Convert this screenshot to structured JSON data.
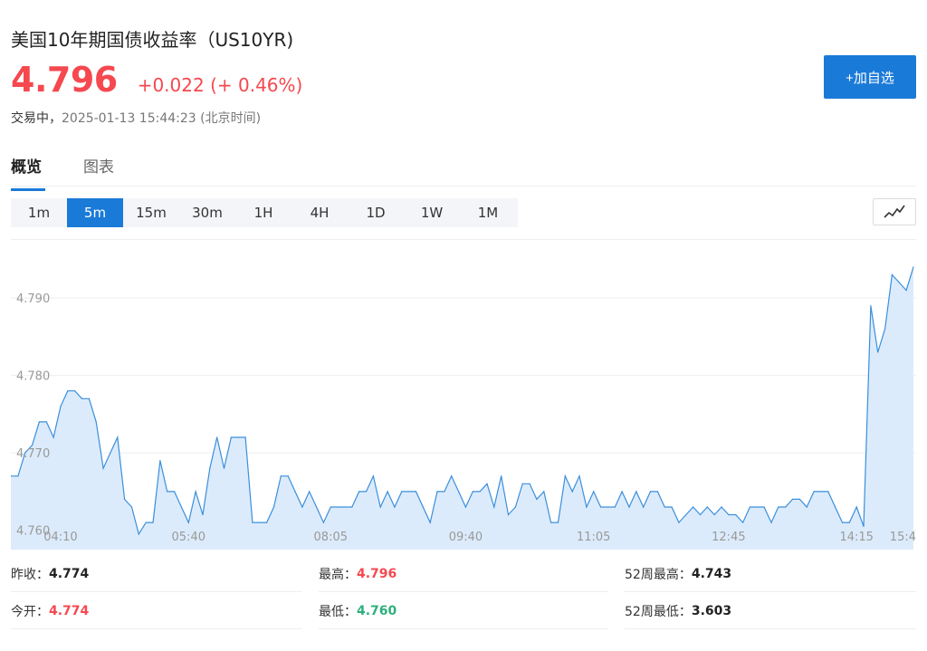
{
  "header": {
    "title": "美国10年期国债收益率（US10YR)",
    "price": "4.796",
    "change": "+0.022 (+ 0.46%)",
    "status_label": "交易中，",
    "timestamp": "2025-01-13 15:44:23 (北京时间)",
    "watch_button": "+加自选"
  },
  "tabs": [
    {
      "label": "概览",
      "active": true
    },
    {
      "label": "图表",
      "active": false
    }
  ],
  "intervals": [
    {
      "label": "1m",
      "active": false
    },
    {
      "label": "5m",
      "active": true
    },
    {
      "label": "15m",
      "active": false
    },
    {
      "label": "30m",
      "active": false
    },
    {
      "label": "1H",
      "active": false
    },
    {
      "label": "4H",
      "active": false
    },
    {
      "label": "1D",
      "active": false
    },
    {
      "label": "1W",
      "active": false
    },
    {
      "label": "1M",
      "active": false
    }
  ],
  "chart_type_icon": "line-chart-icon",
  "colors": {
    "up": "#f5484f",
    "down": "#2db07c",
    "accent": "#1a7ad8",
    "line": "#3a8fdc",
    "fill": "#dcebfb"
  },
  "chart_data": {
    "type": "area",
    "title": "",
    "xlabel": "",
    "ylabel": "",
    "ylim": [
      4.7575,
      4.7975
    ],
    "y_ticks": [
      "4.790",
      "4.780",
      "4.770",
      "4.760"
    ],
    "y_tick_values": [
      4.79,
      4.78,
      4.77,
      4.76
    ],
    "x_ticks": [
      "04:10",
      "05:40",
      "08:05",
      "09:40",
      "11:05",
      "12:45",
      "14:15",
      "15:4"
    ],
    "x_tick_index": [
      7,
      25,
      45,
      64,
      82,
      101,
      119,
      137
    ],
    "grid": true,
    "series": [
      {
        "values": [
          4.767,
          4.767,
          4.77,
          4.771,
          4.774,
          4.774,
          4.772,
          4.776,
          4.778,
          4.778,
          4.777,
          4.777,
          4.774,
          4.768,
          4.77,
          4.772,
          4.764,
          4.763,
          4.7595,
          4.761,
          4.761,
          4.769,
          4.765,
          4.765,
          4.763,
          4.761,
          4.765,
          4.762,
          4.768,
          4.772,
          4.768,
          4.772,
          4.772,
          4.772,
          4.761,
          4.761,
          4.761,
          4.763,
          4.767,
          4.767,
          4.765,
          4.763,
          4.765,
          4.763,
          4.761,
          4.763,
          4.763,
          4.763,
          4.763,
          4.765,
          4.765,
          4.767,
          4.763,
          4.765,
          4.763,
          4.765,
          4.765,
          4.765,
          4.763,
          4.761,
          4.765,
          4.765,
          4.767,
          4.765,
          4.763,
          4.765,
          4.765,
          4.766,
          4.763,
          4.767,
          4.762,
          4.763,
          4.766,
          4.766,
          4.764,
          4.765,
          4.761,
          4.761,
          4.767,
          4.765,
          4.767,
          4.763,
          4.765,
          4.763,
          4.763,
          4.763,
          4.765,
          4.763,
          4.765,
          4.763,
          4.765,
          4.765,
          4.763,
          4.763,
          4.761,
          4.762,
          4.763,
          4.762,
          4.763,
          4.762,
          4.763,
          4.762,
          4.762,
          4.761,
          4.763,
          4.763,
          4.763,
          4.761,
          4.763,
          4.763,
          4.764,
          4.764,
          4.763,
          4.765,
          4.765,
          4.765,
          4.763,
          4.761,
          4.761,
          4.763,
          4.7605,
          4.789,
          4.783,
          4.786,
          4.793,
          4.792,
          4.791,
          4.794
        ]
      }
    ]
  },
  "stats": [
    {
      "label": "昨收：",
      "value": "4.774",
      "tone": "dark"
    },
    {
      "label": "最高：",
      "value": "4.796",
      "tone": "red"
    },
    {
      "label": "52周最高：",
      "value": "4.743",
      "tone": "dark"
    },
    {
      "label": "今开：",
      "value": "4.774",
      "tone": "red"
    },
    {
      "label": "最低：",
      "value": "4.760",
      "tone": "green"
    },
    {
      "label": "52周最低：",
      "value": "3.603",
      "tone": "dark"
    }
  ]
}
